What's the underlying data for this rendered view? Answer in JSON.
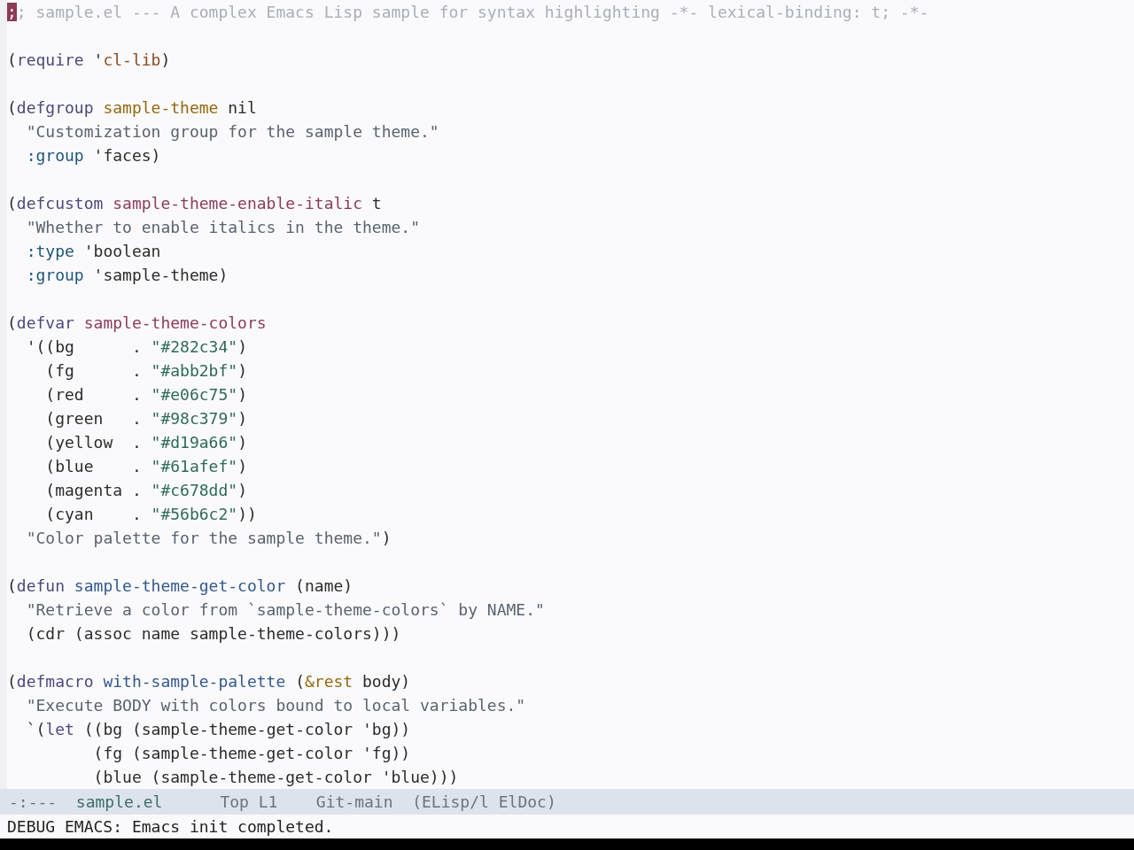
{
  "buffer": {
    "lines": [
      {
        "kind": "code",
        "tokens": [
          {
            "text": ";",
            "kind": "cursor"
          },
          {
            "text": "; sample.el --- A complex Emacs Lisp sample for syntax highlighting -*- lexical-binding: t; -*-",
            "kind": "comment"
          }
        ]
      },
      {
        "kind": "blank"
      },
      {
        "kind": "code",
        "tokens": [
          {
            "text": "(",
            "kind": "plain"
          },
          {
            "text": "require",
            "kind": "keyword"
          },
          {
            "text": " '",
            "kind": "plain"
          },
          {
            "text": "cl-lib",
            "kind": "constant"
          },
          {
            "text": ")",
            "kind": "plain"
          }
        ]
      },
      {
        "kind": "blank"
      },
      {
        "kind": "code",
        "tokens": [
          {
            "text": "(",
            "kind": "plain"
          },
          {
            "text": "defgroup",
            "kind": "keyword"
          },
          {
            "text": " sample-theme",
            "kind": "type"
          },
          {
            "text": " nil",
            "kind": "plain"
          }
        ]
      },
      {
        "kind": "code",
        "tokens": [
          {
            "text": "  \"Customization group for the sample theme.\"",
            "kind": "doc"
          }
        ]
      },
      {
        "kind": "code",
        "tokens": [
          {
            "text": "  :group",
            "kind": "builtin"
          },
          {
            "text": " 'faces)",
            "kind": "plain"
          }
        ]
      },
      {
        "kind": "blank"
      },
      {
        "kind": "code",
        "tokens": [
          {
            "text": "(",
            "kind": "plain"
          },
          {
            "text": "defcustom",
            "kind": "keyword"
          },
          {
            "text": " sample-theme-enable-italic",
            "kind": "variable"
          },
          {
            "text": " t",
            "kind": "plain"
          }
        ]
      },
      {
        "kind": "code",
        "tokens": [
          {
            "text": "  \"Whether to enable italics in the theme.\"",
            "kind": "doc"
          }
        ]
      },
      {
        "kind": "code",
        "tokens": [
          {
            "text": "  :type",
            "kind": "builtin"
          },
          {
            "text": " 'boolean",
            "kind": "plain"
          }
        ]
      },
      {
        "kind": "code",
        "tokens": [
          {
            "text": "  :group",
            "kind": "builtin"
          },
          {
            "text": " 'sample-theme)",
            "kind": "plain"
          }
        ]
      },
      {
        "kind": "blank"
      },
      {
        "kind": "code",
        "tokens": [
          {
            "text": "(",
            "kind": "plain"
          },
          {
            "text": "defvar",
            "kind": "keyword"
          },
          {
            "text": " sample-theme-colors",
            "kind": "variable"
          }
        ]
      },
      {
        "kind": "code",
        "tokens": [
          {
            "text": "  '((bg      . ",
            "kind": "plain"
          },
          {
            "text": "\"#282c34\"",
            "kind": "string"
          },
          {
            "text": ")",
            "kind": "plain"
          }
        ]
      },
      {
        "kind": "code",
        "tokens": [
          {
            "text": "    (fg      . ",
            "kind": "plain"
          },
          {
            "text": "\"#abb2bf\"",
            "kind": "string"
          },
          {
            "text": ")",
            "kind": "plain"
          }
        ]
      },
      {
        "kind": "code",
        "tokens": [
          {
            "text": "    (red     . ",
            "kind": "plain"
          },
          {
            "text": "\"#e06c75\"",
            "kind": "string"
          },
          {
            "text": ")",
            "kind": "plain"
          }
        ]
      },
      {
        "kind": "code",
        "tokens": [
          {
            "text": "    (green   . ",
            "kind": "plain"
          },
          {
            "text": "\"#98c379\"",
            "kind": "string"
          },
          {
            "text": ")",
            "kind": "plain"
          }
        ]
      },
      {
        "kind": "code",
        "tokens": [
          {
            "text": "    (yellow  . ",
            "kind": "plain"
          },
          {
            "text": "\"#d19a66\"",
            "kind": "string"
          },
          {
            "text": ")",
            "kind": "plain"
          }
        ]
      },
      {
        "kind": "code",
        "tokens": [
          {
            "text": "    (blue    . ",
            "kind": "plain"
          },
          {
            "text": "\"#61afef\"",
            "kind": "string"
          },
          {
            "text": ")",
            "kind": "plain"
          }
        ]
      },
      {
        "kind": "code",
        "tokens": [
          {
            "text": "    (magenta . ",
            "kind": "plain"
          },
          {
            "text": "\"#c678dd\"",
            "kind": "string"
          },
          {
            "text": ")",
            "kind": "plain"
          }
        ]
      },
      {
        "kind": "code",
        "tokens": [
          {
            "text": "    (cyan    . ",
            "kind": "plain"
          },
          {
            "text": "\"#56b6c2\"",
            "kind": "string"
          },
          {
            "text": "))",
            "kind": "plain"
          }
        ]
      },
      {
        "kind": "code",
        "tokens": [
          {
            "text": "  \"Color palette for the sample theme.\"",
            "kind": "doc"
          },
          {
            "text": ")",
            "kind": "plain"
          }
        ]
      },
      {
        "kind": "blank"
      },
      {
        "kind": "code",
        "tokens": [
          {
            "text": "(",
            "kind": "plain"
          },
          {
            "text": "defun",
            "kind": "keyword"
          },
          {
            "text": " sample-theme-get-color",
            "kind": "function"
          },
          {
            "text": " (name)",
            "kind": "plain"
          }
        ]
      },
      {
        "kind": "code",
        "tokens": [
          {
            "text": "  \"Retrieve a color from `sample-theme-colors` by NAME.\"",
            "kind": "doc"
          }
        ]
      },
      {
        "kind": "code",
        "tokens": [
          {
            "text": "  (cdr (assoc name sample-theme-colors)))",
            "kind": "plain"
          }
        ]
      },
      {
        "kind": "blank"
      },
      {
        "kind": "code",
        "tokens": [
          {
            "text": "(",
            "kind": "plain"
          },
          {
            "text": "defmacro",
            "kind": "keyword"
          },
          {
            "text": " with-sample-palette",
            "kind": "function"
          },
          {
            "text": " (",
            "kind": "plain"
          },
          {
            "text": "&rest",
            "kind": "type"
          },
          {
            "text": " body)",
            "kind": "plain"
          }
        ]
      },
      {
        "kind": "code",
        "tokens": [
          {
            "text": "  \"Execute BODY with colors bound to local variables.\"",
            "kind": "doc"
          }
        ]
      },
      {
        "kind": "code",
        "tokens": [
          {
            "text": "  `(",
            "kind": "plain"
          },
          {
            "text": "let",
            "kind": "keyword"
          },
          {
            "text": " ((bg (sample-theme-get-color 'bg))",
            "kind": "plain"
          }
        ]
      },
      {
        "kind": "code",
        "tokens": [
          {
            "text": "         (fg (sample-theme-get-color 'fg))",
            "kind": "plain"
          }
        ]
      },
      {
        "kind": "code",
        "tokens": [
          {
            "text": "         (blue (sample-theme-get-color 'blue)))",
            "kind": "plain"
          }
        ]
      }
    ]
  },
  "mode_line": {
    "status": "-:---",
    "buffer_name": "sample.el",
    "position": "Top L1",
    "branch": "Git-main",
    "modes": "(ELisp/l ElDoc)"
  },
  "echo_area": {
    "message": "DEBUG EMACS: Emacs init completed."
  }
}
